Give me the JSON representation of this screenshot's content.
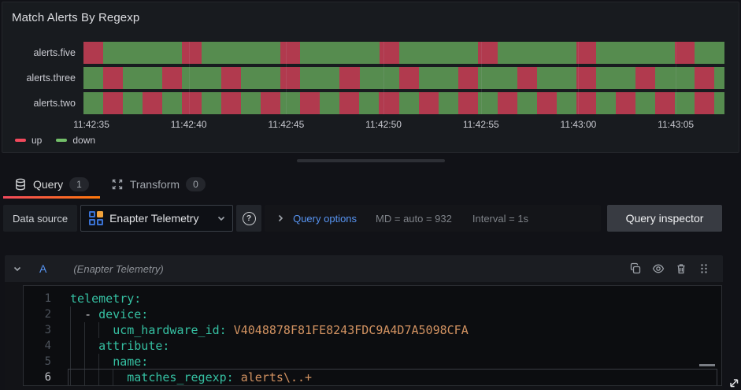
{
  "panel": {
    "title": "Match Alerts By Regexp"
  },
  "chart_data": {
    "type": "state-timeline",
    "title": "Match Alerts By Regexp",
    "x_start": "11:42:35",
    "x_end_approx": "11:43:07",
    "span_seconds": 32.5,
    "tick_seconds": [
      0,
      5,
      10,
      15,
      20,
      25,
      30
    ],
    "tick_labels": [
      "11:42:35",
      "11:42:40",
      "11:42:45",
      "11:42:50",
      "11:42:55",
      "11:43:00",
      "11:43:05"
    ],
    "bar_colors": {
      "up": "#b13a4e",
      "down": "#568c4f"
    },
    "legend": [
      {
        "label": "up",
        "color": "#f2495c"
      },
      {
        "label": "down",
        "color": "#73bf69"
      }
    ],
    "series": [
      {
        "name": "alerts.five",
        "segments": [
          [
            "up",
            1
          ],
          [
            "down",
            4
          ],
          [
            "up",
            1
          ],
          [
            "down",
            4
          ],
          [
            "up",
            1
          ],
          [
            "down",
            4
          ],
          [
            "up",
            1
          ],
          [
            "down",
            4
          ],
          [
            "up",
            1
          ],
          [
            "down",
            4
          ],
          [
            "up",
            1
          ],
          [
            "down",
            4
          ],
          [
            "up",
            1
          ],
          [
            "down",
            1.5
          ]
        ]
      },
      {
        "name": "alerts.three",
        "segments": [
          [
            "down",
            1
          ],
          [
            "up",
            1
          ],
          [
            "down",
            2
          ],
          [
            "up",
            1
          ],
          [
            "down",
            2
          ],
          [
            "up",
            1
          ],
          [
            "down",
            2
          ],
          [
            "up",
            1
          ],
          [
            "down",
            2
          ],
          [
            "up",
            1
          ],
          [
            "down",
            2
          ],
          [
            "up",
            1
          ],
          [
            "down",
            2
          ],
          [
            "up",
            1
          ],
          [
            "down",
            2
          ],
          [
            "up",
            1
          ],
          [
            "down",
            2
          ],
          [
            "up",
            1
          ],
          [
            "down",
            2
          ],
          [
            "up",
            1
          ],
          [
            "down",
            2
          ],
          [
            "up",
            1
          ],
          [
            "down",
            0.5
          ]
        ]
      },
      {
        "name": "alerts.two",
        "segments": [
          [
            "down",
            1
          ],
          [
            "up",
            1
          ],
          [
            "down",
            1
          ],
          [
            "up",
            1
          ],
          [
            "down",
            1
          ],
          [
            "up",
            1
          ],
          [
            "down",
            1
          ],
          [
            "up",
            1
          ],
          [
            "down",
            1
          ],
          [
            "up",
            1
          ],
          [
            "down",
            1
          ],
          [
            "up",
            1
          ],
          [
            "down",
            1
          ],
          [
            "up",
            1
          ],
          [
            "down",
            1
          ],
          [
            "up",
            1
          ],
          [
            "down",
            1
          ],
          [
            "up",
            1
          ],
          [
            "down",
            1
          ],
          [
            "up",
            1
          ],
          [
            "down",
            1
          ],
          [
            "up",
            1
          ],
          [
            "down",
            1
          ],
          [
            "up",
            1
          ],
          [
            "down",
            1
          ],
          [
            "up",
            1
          ],
          [
            "down",
            1
          ],
          [
            "up",
            1
          ],
          [
            "down",
            1
          ],
          [
            "up",
            1
          ],
          [
            "down",
            1
          ],
          [
            "up",
            1
          ],
          [
            "down",
            0.5
          ]
        ]
      }
    ]
  },
  "tabs": [
    {
      "label": "Query",
      "badge": "1",
      "icon": "database-icon",
      "active": true
    },
    {
      "label": "Transform",
      "badge": "0",
      "icon": "transform-icon",
      "active": false
    }
  ],
  "toolbar": {
    "datasource_label": "Data source",
    "datasource_value": "Enapter Telemetry",
    "help_glyph": "?",
    "query_options_label": "Query options",
    "md_text": "MD = auto = 932",
    "interval_text": "Interval = 1s",
    "inspector_label": "Query inspector"
  },
  "query_row": {
    "ref_id": "A",
    "datasource_hint": "(Enapter Telemetry)"
  },
  "editor": {
    "lines": [
      {
        "n": "1",
        "indent": 0,
        "guides": 0,
        "tokens": [
          {
            "c": "key",
            "t": "telemetry:"
          }
        ]
      },
      {
        "n": "2",
        "indent": 2,
        "guides": 1,
        "tokens": [
          {
            "c": "plain",
            "t": "- "
          },
          {
            "c": "key",
            "t": "device:"
          }
        ]
      },
      {
        "n": "3",
        "indent": 6,
        "guides": 3,
        "tokens": [
          {
            "c": "key",
            "t": "ucm_hardware_id:"
          },
          {
            "c": "plain",
            "t": " "
          },
          {
            "c": "value",
            "t": "V4048878F81FE8243FDC9A4D7A5098CFA"
          }
        ]
      },
      {
        "n": "4",
        "indent": 4,
        "guides": 2,
        "tokens": [
          {
            "c": "key",
            "t": "attribute:"
          }
        ]
      },
      {
        "n": "5",
        "indent": 6,
        "guides": 3,
        "tokens": [
          {
            "c": "key",
            "t": "name:"
          }
        ]
      },
      {
        "n": "6",
        "indent": 8,
        "guides": 4,
        "active": true,
        "tokens": [
          {
            "c": "key",
            "t": "matches_regexp:"
          },
          {
            "c": "plain",
            "t": " "
          },
          {
            "c": "value",
            "t": "alerts\\..+"
          }
        ]
      }
    ]
  }
}
